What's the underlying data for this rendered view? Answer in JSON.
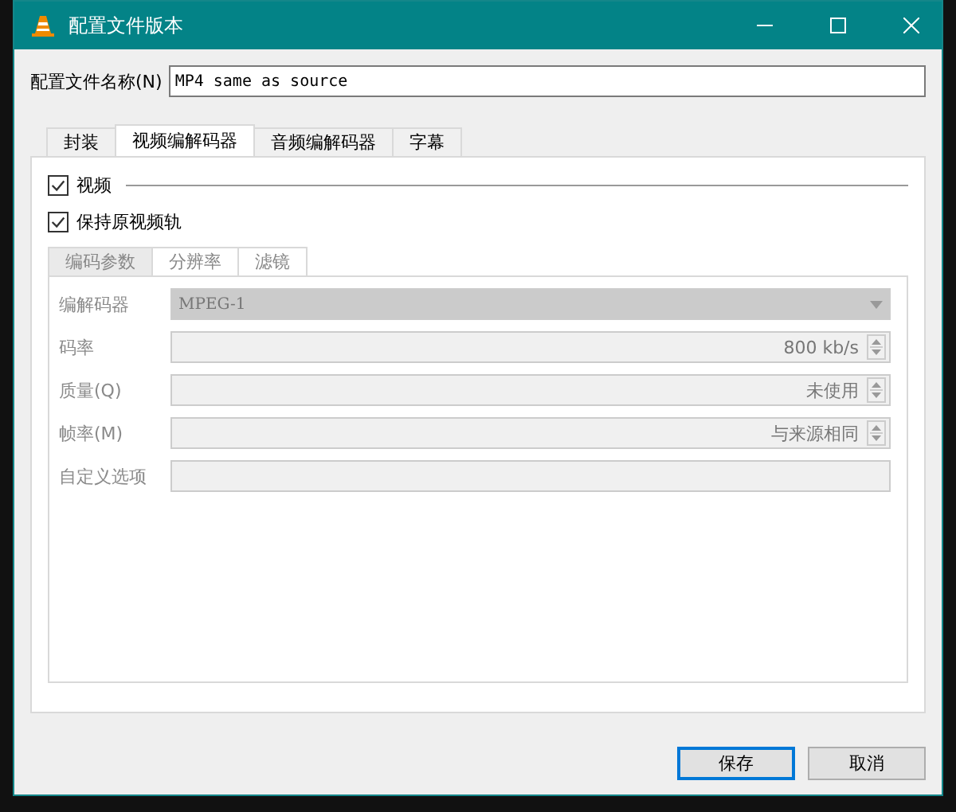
{
  "window": {
    "title": "配置文件版本"
  },
  "profile_name": {
    "label": "配置文件名称(N)",
    "value": "MP4 same as source"
  },
  "tabs": [
    {
      "label": "封装",
      "selected": false
    },
    {
      "label": "视频编解码器",
      "selected": true
    },
    {
      "label": "音频编解码器",
      "selected": false
    },
    {
      "label": "字幕",
      "selected": false
    }
  ],
  "video_checkbox": {
    "label": "视频",
    "checked": true
  },
  "keep_track": {
    "label": "保持原视频轨",
    "checked": true
  },
  "sub_tabs": [
    {
      "label": "编码参数",
      "selected": true
    },
    {
      "label": "分辨率",
      "selected": false
    },
    {
      "label": "滤镜",
      "selected": false
    }
  ],
  "fields": [
    {
      "label": "编解码器",
      "kind": "combo",
      "value": "MPEG-1",
      "disabled": true
    },
    {
      "label": "码率",
      "kind": "spin",
      "value": "800 kb/s",
      "disabled": true
    },
    {
      "label": "质量(Q)",
      "kind": "spin",
      "value": "未使用",
      "disabled": true
    },
    {
      "label": "帧率(M)",
      "kind": "spin",
      "value": "与来源相同",
      "disabled": true
    },
    {
      "label": "自定义选项",
      "kind": "text",
      "disabled": true
    }
  ],
  "buttons": [
    {
      "label": "保存",
      "default": true
    },
    {
      "label": "取消",
      "default": false
    }
  ]
}
